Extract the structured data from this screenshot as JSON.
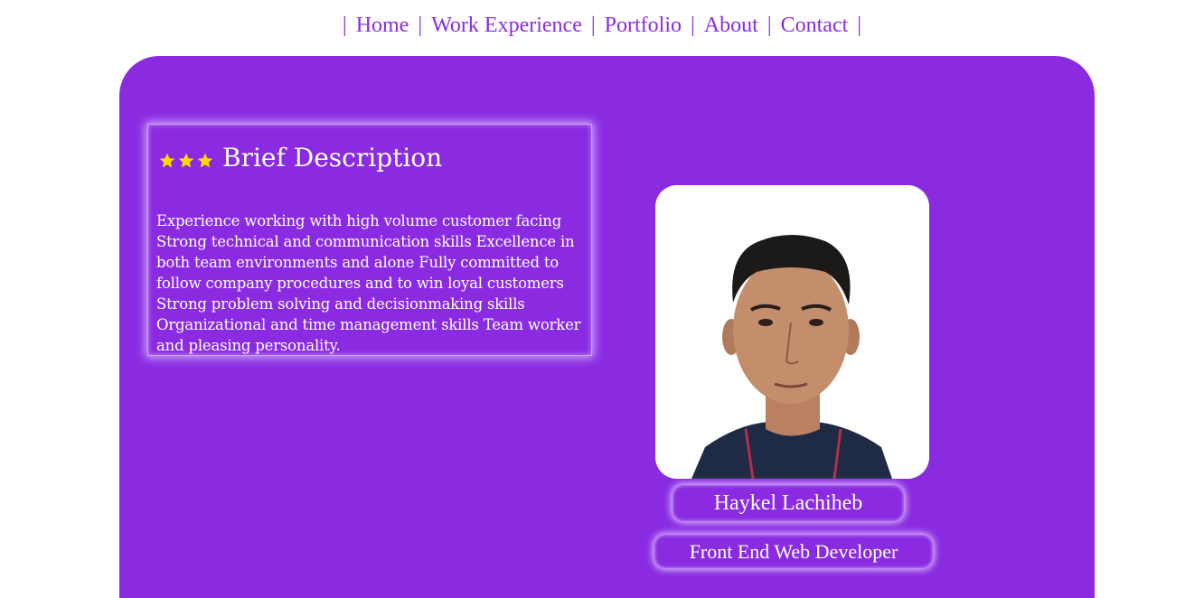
{
  "nav": {
    "separator": "|",
    "items": [
      {
        "label": "Home"
      },
      {
        "label": "Work Experience"
      },
      {
        "label": "Portfolio"
      },
      {
        "label": "About"
      },
      {
        "label": "Contact"
      }
    ]
  },
  "description": {
    "title": "Brief Description",
    "star_count": 3,
    "star_color": "#ffd700",
    "text": "Experience working with high volume customer facing Strong technical and communication skills Excellence in both team environments and alone Fully committed to follow company procedures and to win loyal customers Strong problem solving and decisionmaking skills Organizational and time management skills Team worker and pleasing personality."
  },
  "profile": {
    "name": "Haykel Lachiheb",
    "role": "Front End Web Developer"
  },
  "colors": {
    "accent": "#8a2be2",
    "text_light": "#ffffff"
  }
}
